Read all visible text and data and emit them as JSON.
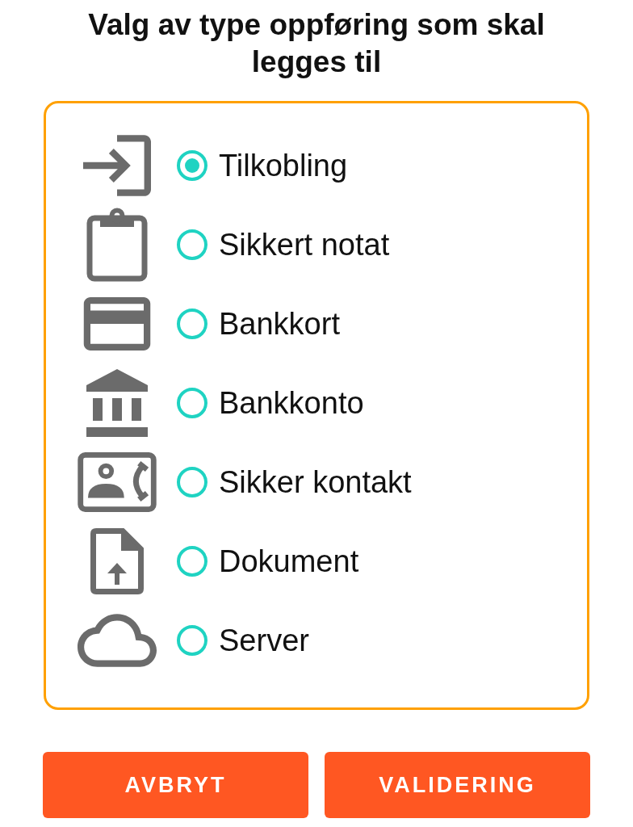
{
  "title": "Valg av type oppføring som skal legges til",
  "options": [
    {
      "label": "Tilkobling",
      "selected": true
    },
    {
      "label": "Sikkert notat",
      "selected": false
    },
    {
      "label": "Bankkort",
      "selected": false
    },
    {
      "label": "Bankkonto",
      "selected": false
    },
    {
      "label": "Sikker kontakt",
      "selected": false
    },
    {
      "label": "Dokument",
      "selected": false
    },
    {
      "label": "Server",
      "selected": false
    }
  ],
  "buttons": [
    {
      "label": "AVBRYT"
    },
    {
      "label": "VALIDERING"
    }
  ]
}
